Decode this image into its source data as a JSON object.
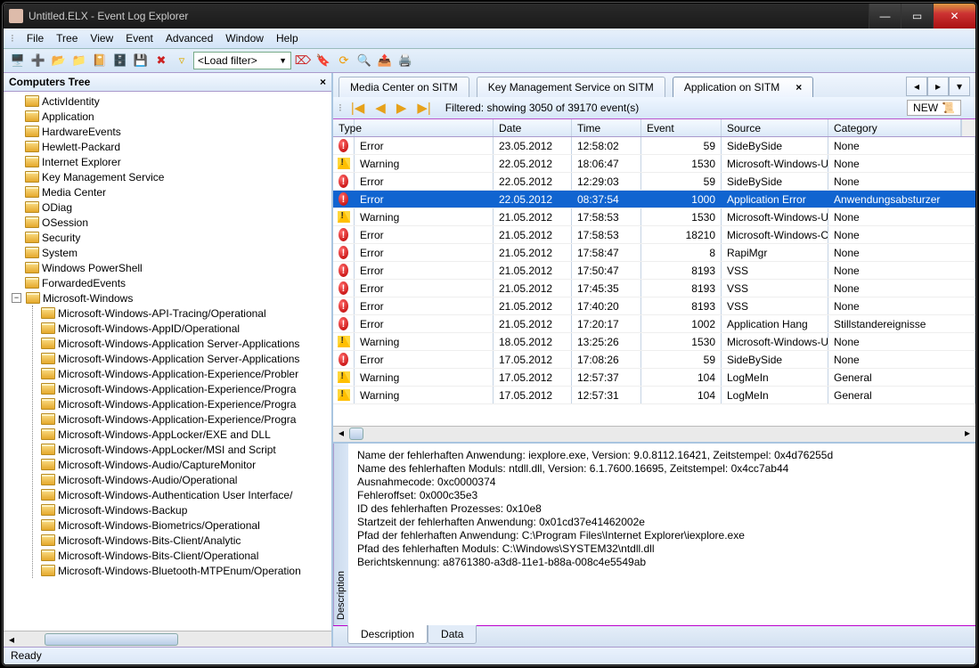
{
  "window_title": "Untitled.ELX - Event Log Explorer",
  "menu": [
    "File",
    "Tree",
    "View",
    "Event",
    "Advanced",
    "Window",
    "Help"
  ],
  "toolbar_filter_label": "<Load filter>",
  "tree_header": "Computers Tree",
  "tree_top": [
    "ActivIdentity",
    "Application",
    "HardwareEvents",
    "Hewlett-Packard",
    "Internet Explorer",
    "Key Management Service",
    "Media Center",
    "ODiag",
    "OSession",
    "Security",
    "System",
    "Windows PowerShell",
    "ForwardedEvents"
  ],
  "tree_expand": "Microsoft-Windows",
  "tree_sub": [
    "Microsoft-Windows-API-Tracing/Operational",
    "Microsoft-Windows-AppID/Operational",
    "Microsoft-Windows-Application Server-Applications",
    "Microsoft-Windows-Application Server-Applications",
    "Microsoft-Windows-Application-Experience/Probler",
    "Microsoft-Windows-Application-Experience/Progra",
    "Microsoft-Windows-Application-Experience/Progra",
    "Microsoft-Windows-Application-Experience/Progra",
    "Microsoft-Windows-AppLocker/EXE and DLL",
    "Microsoft-Windows-AppLocker/MSI and Script",
    "Microsoft-Windows-Audio/CaptureMonitor",
    "Microsoft-Windows-Audio/Operational",
    "Microsoft-Windows-Authentication User Interface/",
    "Microsoft-Windows-Backup",
    "Microsoft-Windows-Biometrics/Operational",
    "Microsoft-Windows-Bits-Client/Analytic",
    "Microsoft-Windows-Bits-Client/Operational",
    "Microsoft-Windows-Bluetooth-MTPEnum/Operation"
  ],
  "tabs": [
    "Media Center on SITM",
    "Key Management Service on SITM",
    "Application on SITM"
  ],
  "active_tab": 2,
  "filter_status": "Filtered: showing 3050 of 39170 event(s)",
  "new_label": "NEW",
  "columns": [
    "Type",
    "Date",
    "Time",
    "Event",
    "Source",
    "Category"
  ],
  "rows": [
    {
      "t": "Error",
      "date": "23.05.2012",
      "time": "12:58:02",
      "ev": "59",
      "src": "SideBySide",
      "cat": "None"
    },
    {
      "t": "Warning",
      "date": "22.05.2012",
      "time": "18:06:47",
      "ev": "1530",
      "src": "Microsoft-Windows-Us",
      "cat": "None"
    },
    {
      "t": "Error",
      "date": "22.05.2012",
      "time": "12:29:03",
      "ev": "59",
      "src": "SideBySide",
      "cat": "None"
    },
    {
      "t": "Error",
      "date": "22.05.2012",
      "time": "08:37:54",
      "ev": "1000",
      "src": "Application Error",
      "cat": "Anwendungsabsturzer",
      "sel": true
    },
    {
      "t": "Warning",
      "date": "21.05.2012",
      "time": "17:58:53",
      "ev": "1530",
      "src": "Microsoft-Windows-Us",
      "cat": "None"
    },
    {
      "t": "Error",
      "date": "21.05.2012",
      "time": "17:58:53",
      "ev": "18210",
      "src": "Microsoft-Windows-CO",
      "cat": "None"
    },
    {
      "t": "Error",
      "date": "21.05.2012",
      "time": "17:58:47",
      "ev": "8",
      "src": "RapiMgr",
      "cat": "None"
    },
    {
      "t": "Error",
      "date": "21.05.2012",
      "time": "17:50:47",
      "ev": "8193",
      "src": "VSS",
      "cat": "None"
    },
    {
      "t": "Error",
      "date": "21.05.2012",
      "time": "17:45:35",
      "ev": "8193",
      "src": "VSS",
      "cat": "None"
    },
    {
      "t": "Error",
      "date": "21.05.2012",
      "time": "17:40:20",
      "ev": "8193",
      "src": "VSS",
      "cat": "None"
    },
    {
      "t": "Error",
      "date": "21.05.2012",
      "time": "17:20:17",
      "ev": "1002",
      "src": "Application Hang",
      "cat": "Stillstandereignisse"
    },
    {
      "t": "Warning",
      "date": "18.05.2012",
      "time": "13:25:26",
      "ev": "1530",
      "src": "Microsoft-Windows-Us",
      "cat": "None"
    },
    {
      "t": "Error",
      "date": "17.05.2012",
      "time": "17:08:26",
      "ev": "59",
      "src": "SideBySide",
      "cat": "None"
    },
    {
      "t": "Warning",
      "date": "17.05.2012",
      "time": "12:57:37",
      "ev": "104",
      "src": "LogMeIn",
      "cat": "General"
    },
    {
      "t": "Warning",
      "date": "17.05.2012",
      "time": "12:57:31",
      "ev": "104",
      "src": "LogMeIn",
      "cat": "General"
    }
  ],
  "desc_label": "Description",
  "description": "Name der fehlerhaften Anwendung: iexplore.exe, Version: 9.0.8112.16421, Zeitstempel: 0x4d76255d\nName des fehlerhaften Moduls: ntdll.dll, Version: 6.1.7600.16695, Zeitstempel: 0x4cc7ab44\nAusnahmecode: 0xc0000374\nFehleroffset: 0x000c35e3\nID des fehlerhaften Prozesses: 0x10e8\nStartzeit der fehlerhaften Anwendung: 0x01cd37e41462002e\nPfad der fehlerhaften Anwendung: C:\\Program Files\\Internet Explorer\\iexplore.exe\nPfad des fehlerhaften Moduls: C:\\Windows\\SYSTEM32\\ntdll.dll\nBerichtskennung: a8761380-a3d8-11e1-b88a-008c4e5549ab",
  "bottom_tabs": [
    "Description",
    "Data"
  ],
  "status": "Ready"
}
